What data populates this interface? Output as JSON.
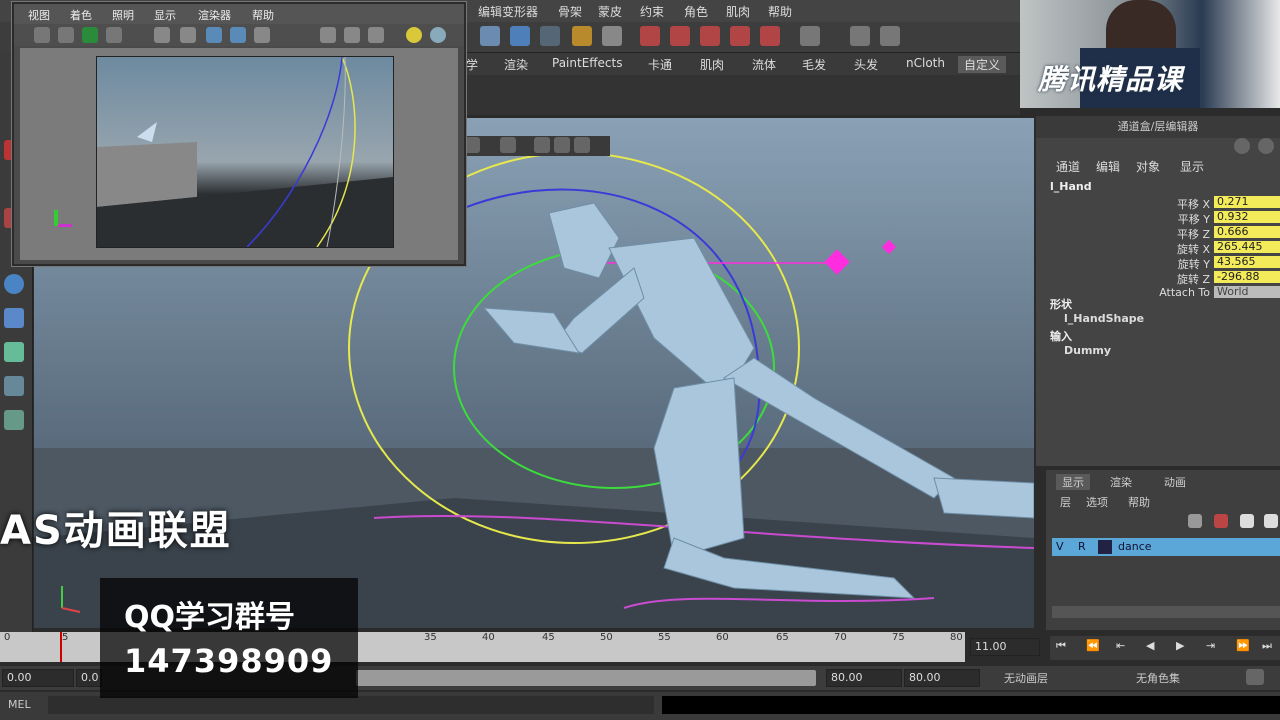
{
  "menubar": {
    "items": [
      "编辑变形器",
      "骨架",
      "蒙皮",
      "约束",
      "角色",
      "肌肉",
      "帮助"
    ]
  },
  "shelf": {
    "tabs": [
      "学",
      "渲染",
      "PaintEffects",
      "卡通",
      "肌肉",
      "流体",
      "毛发",
      "头发",
      "nCloth",
      "自定义"
    ],
    "selected_tab": "自定义"
  },
  "float_window": {
    "menu": [
      "视图",
      "着色",
      "照明",
      "显示",
      "渲染器",
      "帮助"
    ]
  },
  "channel_box": {
    "header": "通道盒/层编辑器",
    "menu": [
      "通道",
      "编辑",
      "对象",
      "显示"
    ],
    "node_name": "l_Hand",
    "attributes": [
      {
        "label": "平移 X",
        "value": "0.271"
      },
      {
        "label": "平移 Y",
        "value": "0.932"
      },
      {
        "label": "平移 Z",
        "value": "0.666"
      },
      {
        "label": "旋转 X",
        "value": "265.445"
      },
      {
        "label": "旋转 Y",
        "value": "43.565"
      },
      {
        "label": "旋转 Z",
        "value": "-296.88"
      },
      {
        "label": "Attach To",
        "value": "World"
      }
    ],
    "shapes_label": "形状",
    "shape_name": "l_HandShape",
    "inputs_label": "输入",
    "input_name": "Dummy"
  },
  "layer_editor": {
    "tabs": [
      "显示",
      "渲染",
      "动画"
    ],
    "menu": [
      "层",
      "选项",
      "帮助"
    ],
    "layer": {
      "v": "V",
      "r": "R",
      "name": "dance"
    }
  },
  "time_slider": {
    "ticks": [
      "0",
      "5",
      "35",
      "40",
      "45",
      "50",
      "55",
      "60",
      "65",
      "70",
      "75",
      "80"
    ],
    "current_time": "11.00"
  },
  "range_bar": {
    "start": "0.00",
    "start2": "0.0",
    "end1": "80.00",
    "end2": "80.00",
    "anim_layer": "无动画层",
    "char_set": "无角色集"
  },
  "command_line": {
    "label": "MEL"
  },
  "overlays": {
    "title": "AS动画联盟",
    "qq_label": "QQ学习群号",
    "qq_number": "147398909",
    "brand": "腾讯精品课"
  },
  "colors": {
    "attr_highlight": "#f3eb5a",
    "layer_highlight": "#5ba7d8",
    "control_magenta": "#ff2de0"
  }
}
